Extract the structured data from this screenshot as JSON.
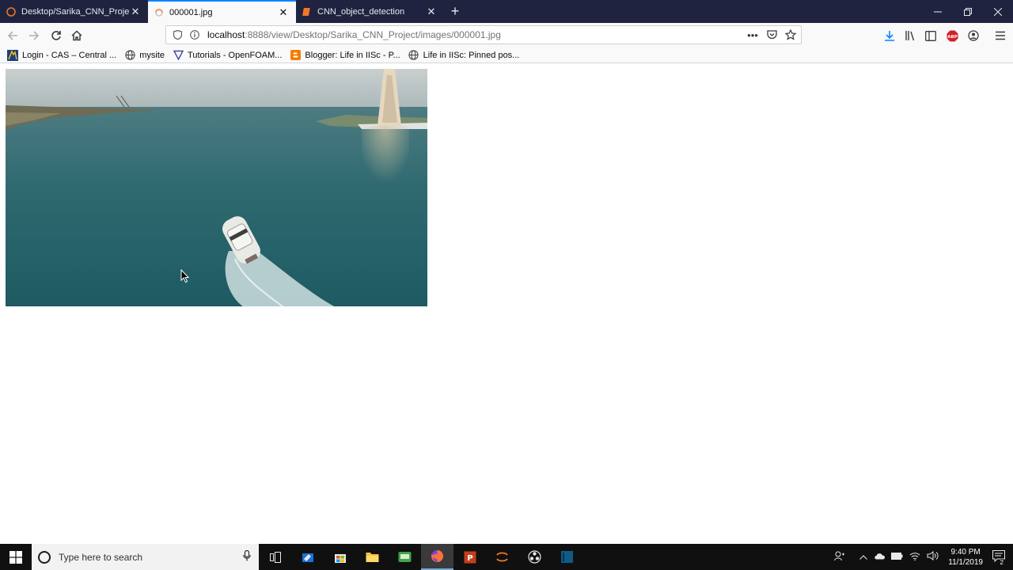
{
  "tabs": [
    {
      "title": "Desktop/Sarika_CNN_Project/images/",
      "active": false,
      "icon": "jupyter-icon"
    },
    {
      "title": "000001.jpg",
      "active": true,
      "icon": "loading-spinner-icon"
    },
    {
      "title": "CNN_object_detection",
      "active": false,
      "icon": "notebook-icon"
    }
  ],
  "address_bar": {
    "host": "localhost",
    "path": ":8888/view/Desktop/Sarika_CNN_Project/images/000001.jpg"
  },
  "bookmarks": [
    {
      "label": "Login - CAS – Central ...",
      "icon": "cas-logo-icon"
    },
    {
      "label": "mysite",
      "icon": "globe-icon"
    },
    {
      "label": "Tutorials - OpenFOAM...",
      "icon": "openfoam-icon"
    },
    {
      "label": "Blogger: Life in IISc - P...",
      "icon": "blogger-icon"
    },
    {
      "label": "Life in IISc: Pinned pos...",
      "icon": "globe-icon"
    }
  ],
  "taskbar": {
    "search_placeholder": "Type here to search",
    "time": "9:40 PM",
    "date": "11/1/2019",
    "notification_count": "2"
  },
  "colors": {
    "tabstrip_bg": "#202340",
    "active_tab_accent": "#0a84ff",
    "taskbar_bg": "#101010"
  }
}
